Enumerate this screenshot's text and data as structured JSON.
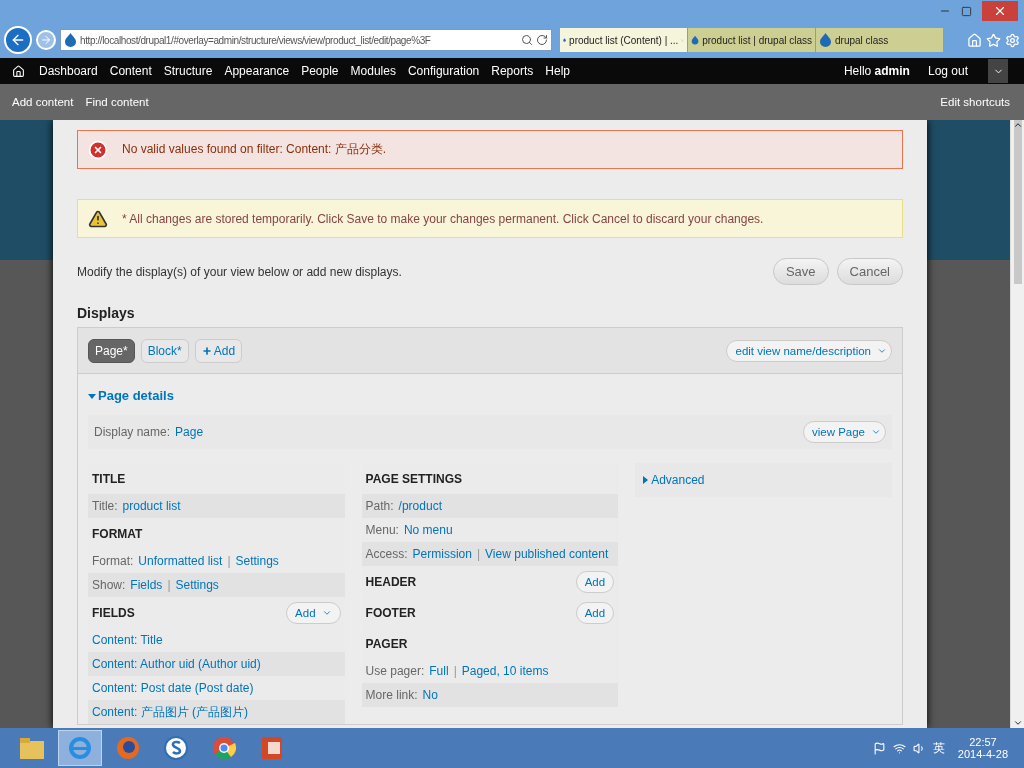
{
  "browser": {
    "address": "http://localhost/drupal1/#overlay=admin/structure/views/view/product_list/edit/page%3F",
    "tabs": [
      {
        "title": "product list (Content) | ...",
        "selected": true,
        "closable": true
      },
      {
        "title": "product list | drupal class",
        "selected": false,
        "closable": false
      },
      {
        "title": "drupal class",
        "selected": false,
        "closable": false
      }
    ]
  },
  "toolbar": {
    "menu": [
      "Dashboard",
      "Content",
      "Structure",
      "Appearance",
      "People",
      "Modules",
      "Configuration",
      "Reports",
      "Help"
    ],
    "greeting": "Hello **admin**",
    "logout": "Log out"
  },
  "shortcuts": {
    "items": [
      "Add content",
      "Find content"
    ],
    "edit": "Edit shortcuts"
  },
  "messages": [
    {
      "kind": "error",
      "text": "No valid values found on filter: Content: 产品分类."
    },
    {
      "kind": "warning",
      "text": "* All changes are stored temporarily. Click Save to make your changes permanent. Click Cancel to discard your changes."
    }
  ],
  "intro": "Modify the display(s) of your view below or add new displays.",
  "buttons": [
    "Save",
    "Cancel"
  ],
  "displays": {
    "heading": "Displays",
    "tabs": [
      {
        "label": "Page*",
        "selected": true
      },
      {
        "label": "Block*",
        "selected": false
      }
    ],
    "add": "Add",
    "edit_button": "edit view name/description"
  },
  "details": {
    "heading": "Page details",
    "expanded": true,
    "display_name_label": "Display name:",
    "display_name": "Page",
    "view_button": "view Page"
  },
  "link_separator": "|",
  "columns": [
    {
      "sections": [
        {
          "title": "TITLE",
          "rows": [
            {
              "label": "Title:",
              "links": [
                "product list"
              ]
            }
          ]
        },
        {
          "title": "FORMAT",
          "rows": [
            {
              "label": "Format:",
              "links": [
                "Unformatted list",
                "Settings"
              ]
            },
            {
              "label": "Show:",
              "links": [
                "Fields",
                "Settings"
              ]
            }
          ]
        },
        {
          "title": "FIELDS",
          "add": {
            "label": "Add",
            "dropdown": true
          },
          "rows": [
            {
              "links": [
                "Content: Title"
              ]
            },
            {
              "links": [
                "Content: Author uid (Author uid)"
              ]
            },
            {
              "links": [
                "Content: Post date (Post date)"
              ]
            },
            {
              "links": [
                "Content: 产品图片 (产品图片)"
              ]
            }
          ]
        }
      ]
    },
    {
      "sections": [
        {
          "title": "PAGE SETTINGS",
          "rows": [
            {
              "label": "Path:",
              "links": [
                "/product"
              ]
            },
            {
              "label": "Menu:",
              "links": [
                "No menu"
              ]
            },
            {
              "label": "Access:",
              "links": [
                "Permission",
                "View published content"
              ]
            }
          ]
        },
        {
          "title": "HEADER",
          "add": {
            "label": "Add",
            "dropdown": false
          }
        },
        {
          "title": "FOOTER",
          "add": {
            "label": "Add",
            "dropdown": false
          }
        },
        {
          "title": "PAGER",
          "rows": [
            {
              "label": "Use pager:",
              "links": [
                "Full",
                "Paged, 10 items"
              ]
            },
            {
              "label": "More link:",
              "links": [
                "No"
              ]
            }
          ]
        }
      ]
    }
  ],
  "advanced": {
    "label": "Advanced",
    "expanded": false
  },
  "taskbar": {
    "apps": [
      {
        "kind": "folder",
        "selected": false
      },
      {
        "kind": "ie",
        "selected": true
      },
      {
        "kind": "firefox",
        "selected": false
      },
      {
        "kind": "s",
        "selected": false
      },
      {
        "kind": "chrome",
        "selected": false
      },
      {
        "kind": "ppt",
        "selected": false
      }
    ],
    "ime": "英",
    "time": "22:57",
    "date": "2014-4-28"
  }
}
